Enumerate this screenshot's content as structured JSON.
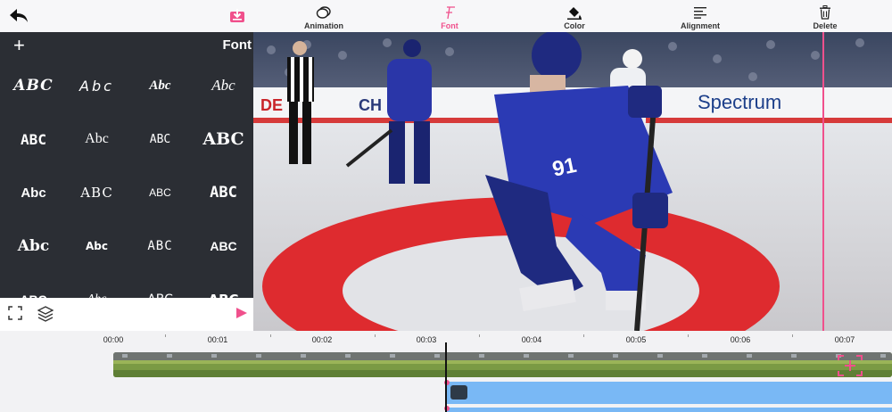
{
  "toolbar": {
    "items": [
      {
        "label": "Animation",
        "icon": "animation-icon"
      },
      {
        "label": "Font",
        "icon": "font-icon",
        "active": true
      },
      {
        "label": "Color",
        "icon": "color-bucket-icon"
      },
      {
        "label": "Alignment",
        "icon": "alignment-icon"
      },
      {
        "label": "Delete",
        "icon": "trash-icon"
      }
    ],
    "back_icon": "back-arrow-icon",
    "export_icon": "download-tray-icon",
    "accent_color": "#f0508c"
  },
  "font_panel": {
    "title": "Font",
    "add_icon": "plus-icon",
    "samples": [
      "ABC",
      "Abc",
      "Abc",
      "Abc",
      "ABC",
      "Abc",
      "ABC",
      "ABC",
      "Abc",
      "ABC",
      "ABC",
      "ABC",
      "Abc",
      "Abc",
      "ABC",
      "ABC",
      "ABC",
      "Abc",
      "ABC",
      "ABC"
    ]
  },
  "left_bar": {
    "fullscreen_icon": "fullscreen-icon",
    "layers_icon": "layers-icon",
    "play_icon": "play-icon"
  },
  "preview": {
    "description": "hockey-player-frame",
    "jersey_number": "91",
    "board_text_1": "Spectrum",
    "board_text_2": "CH",
    "board_text_3": "DE"
  },
  "timeline": {
    "ticks": [
      "00:00",
      "00:01",
      "00:02",
      "00:03",
      "00:04",
      "00:05",
      "00:06",
      "00:07"
    ],
    "add_media_icon": "add-media-icon"
  }
}
